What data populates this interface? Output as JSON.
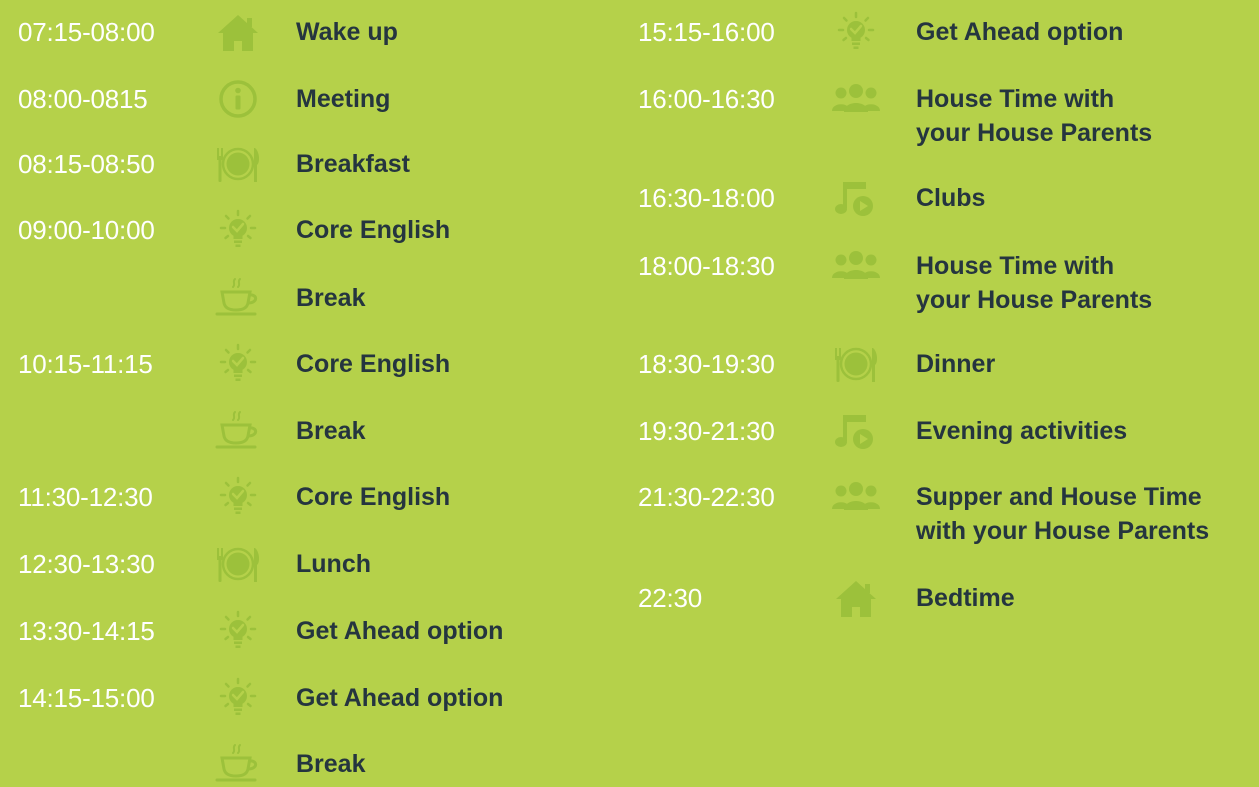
{
  "colors": {
    "background": "#b5d14a",
    "time_text": "#ffffff",
    "label_text": "#25353f",
    "icon": "#9cc13b"
  },
  "left": [
    {
      "time": "07:15-08:00",
      "icon": "house-icon",
      "label": [
        "Wake up"
      ]
    },
    {
      "time": "08:00-0815",
      "icon": "info-icon",
      "label": [
        "Meeting"
      ]
    },
    {
      "time": "08:15-08:50",
      "icon": "meal-icon",
      "label": [
        "Breakfast"
      ]
    },
    {
      "time": "09:00-10:00",
      "icon": "lightbulb-icon",
      "label": [
        "Core English"
      ]
    },
    {
      "time": "",
      "icon": "coffee-cup-icon",
      "label": [
        "Break"
      ]
    },
    {
      "time": "10:15-11:15",
      "icon": "lightbulb-icon",
      "label": [
        "Core English"
      ]
    },
    {
      "time": "",
      "icon": "coffee-cup-icon",
      "label": [
        "Break"
      ]
    },
    {
      "time": "11:30-12:30",
      "icon": "lightbulb-icon",
      "label": [
        "Core English"
      ]
    },
    {
      "time": "12:30-13:30",
      "icon": "meal-icon",
      "label": [
        "Lunch"
      ]
    },
    {
      "time": "13:30-14:15",
      "icon": "lightbulb-icon",
      "label": [
        "Get Ahead option"
      ]
    },
    {
      "time": "14:15-15:00",
      "icon": "lightbulb-icon",
      "label": [
        "Get Ahead option"
      ]
    },
    {
      "time": "",
      "icon": "coffee-cup-icon",
      "label": [
        "Break"
      ]
    }
  ],
  "right": [
    {
      "time": "15:15-16:00",
      "icon": "lightbulb-icon",
      "label": [
        "Get Ahead option"
      ]
    },
    {
      "time": "16:00-16:30",
      "icon": "group-icon",
      "label": [
        "House Time with",
        "your House Parents"
      ]
    },
    {
      "time": "16:30-18:00",
      "icon": "music-icon",
      "label": [
        "Clubs"
      ]
    },
    {
      "time": "18:00-18:30",
      "icon": "group-icon",
      "label": [
        "House Time with",
        "your House Parents"
      ]
    },
    {
      "time": "18:30-19:30",
      "icon": "meal-icon",
      "label": [
        "Dinner"
      ]
    },
    {
      "time": "19:30-21:30",
      "icon": "music-icon",
      "label": [
        "Evening activities"
      ]
    },
    {
      "time": "21:30-22:30",
      "icon": "group-icon",
      "label": [
        "Supper and House Time",
        "with your House Parents"
      ]
    },
    {
      "time": "22:30",
      "icon": "house-icon",
      "label": [
        "Bedtime"
      ]
    }
  ]
}
